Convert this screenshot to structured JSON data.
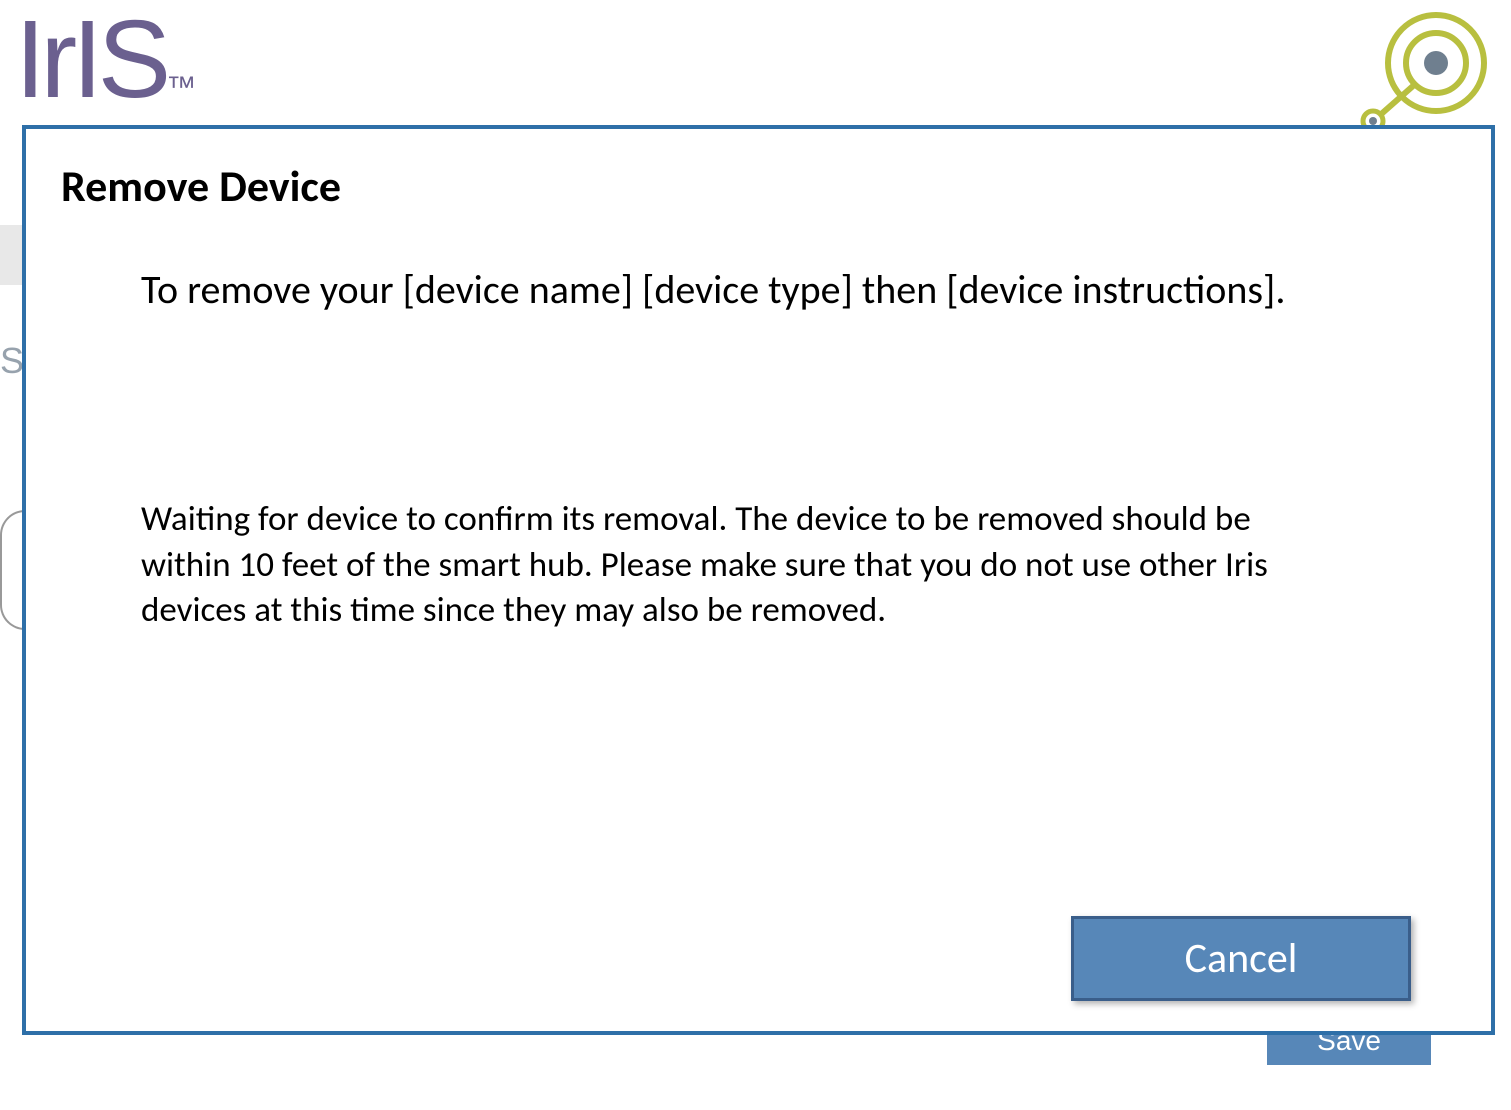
{
  "brand": {
    "name": "IrIS"
  },
  "background": {
    "saveLabel": "Save",
    "sideLetter": "S"
  },
  "modal": {
    "title": "Remove Device",
    "instructionText": "To remove your [device name] [device type] then [device instructions].",
    "waitingText": "Waiting for device to confirm its removal. The device to be removed should be within 10 feet of the smart hub. Please make sure that you do not use other Iris devices at this time since they may also be removed.",
    "cancelLabel": "Cancel"
  },
  "colors": {
    "modalBorder": "#2e6fa8",
    "buttonBg": "#5787b8",
    "brandText": "#6b608f",
    "targetGreen": "#b8bf3f",
    "targetGray": "#6f7f8f"
  }
}
